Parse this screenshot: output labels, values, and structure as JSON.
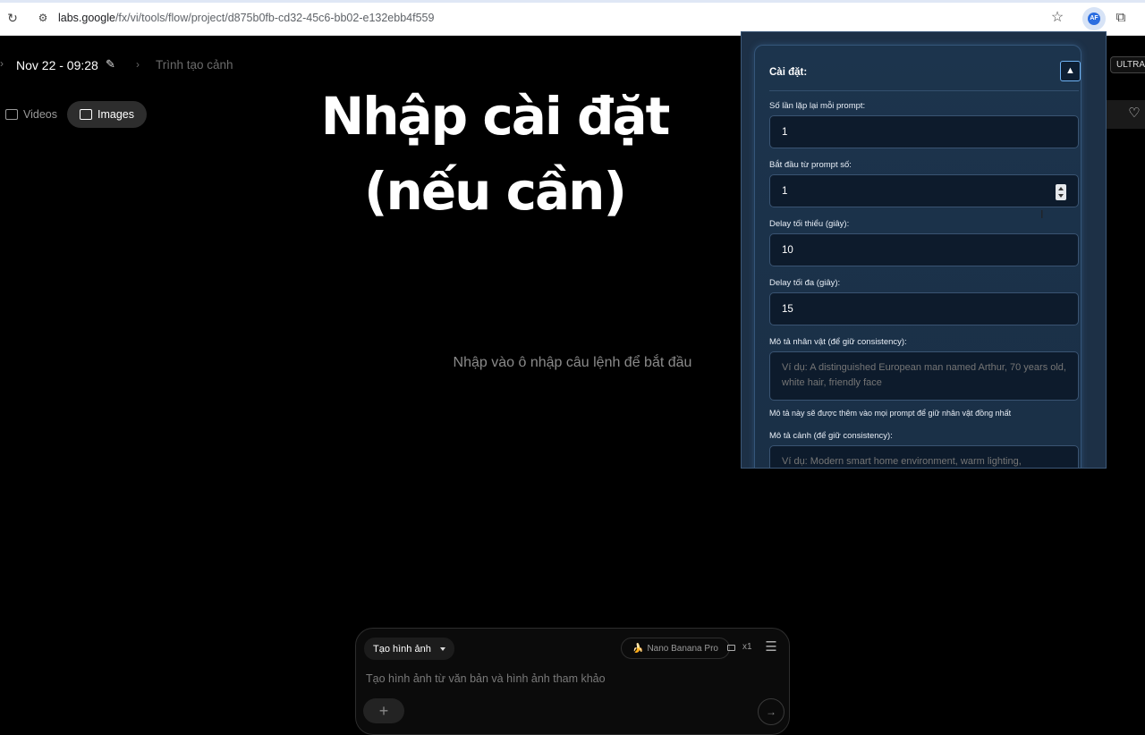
{
  "browser": {
    "url_host": "labs.google",
    "url_path": "/fx/vi/tools/flow/project/d875b0fb-cd32-45c6-bb02-e132ebb4f559"
  },
  "header": {
    "project_title": "Nov 22 - 09:28",
    "breadcrumb_label": "Trình tạo cảnh",
    "tabs": [
      {
        "label": "Videos",
        "icon": "video-icon"
      },
      {
        "label": "Images",
        "icon": "image-icon"
      }
    ],
    "plan_badge": "ULTRA"
  },
  "overlay": {
    "line1": "Nhập cài đặt",
    "line2": "(nếu cần)"
  },
  "main": {
    "empty_hint": "Nhập vào ô nhập câu lệnh để bắt đầu"
  },
  "composer": {
    "mode_label": "Tạo hình ảnh",
    "model_label": "Nano Banana Pro",
    "model_emoji": "🍌",
    "count_label": "x1",
    "prompt_placeholder": "Tạo hình ảnh từ văn bản và hình ảnh tham khảo"
  },
  "settings": {
    "title": "Cài đặt:",
    "fields": {
      "repeat_label": "Số lần lặp lại mỗi prompt:",
      "repeat_value": "1",
      "start_label": "Bắt đầu từ prompt số:",
      "start_value": "1",
      "delay_min_label": "Delay tối thiểu (giây):",
      "delay_min_value": "10",
      "delay_max_label": "Delay tối đa (giây):",
      "delay_max_value": "15",
      "character_label": "Mô tả nhân vật (để giữ consistency):",
      "character_placeholder": "Ví dụ: A distinguished European man named Arthur, 70 years old, white hair, friendly face",
      "character_help": "Mô tả này sẽ được thêm vào mọi prompt để giữ nhân vật đồng nhất",
      "scene_label": "Mô tả cảnh (để giữ consistency):",
      "scene_placeholder": "Ví dụ: Modern smart home environment, warm lighting,"
    }
  },
  "colors": {
    "panel_bg": "#1d3046",
    "panel_border": "#3c5878",
    "accent_blue": "#6fb3f5"
  }
}
